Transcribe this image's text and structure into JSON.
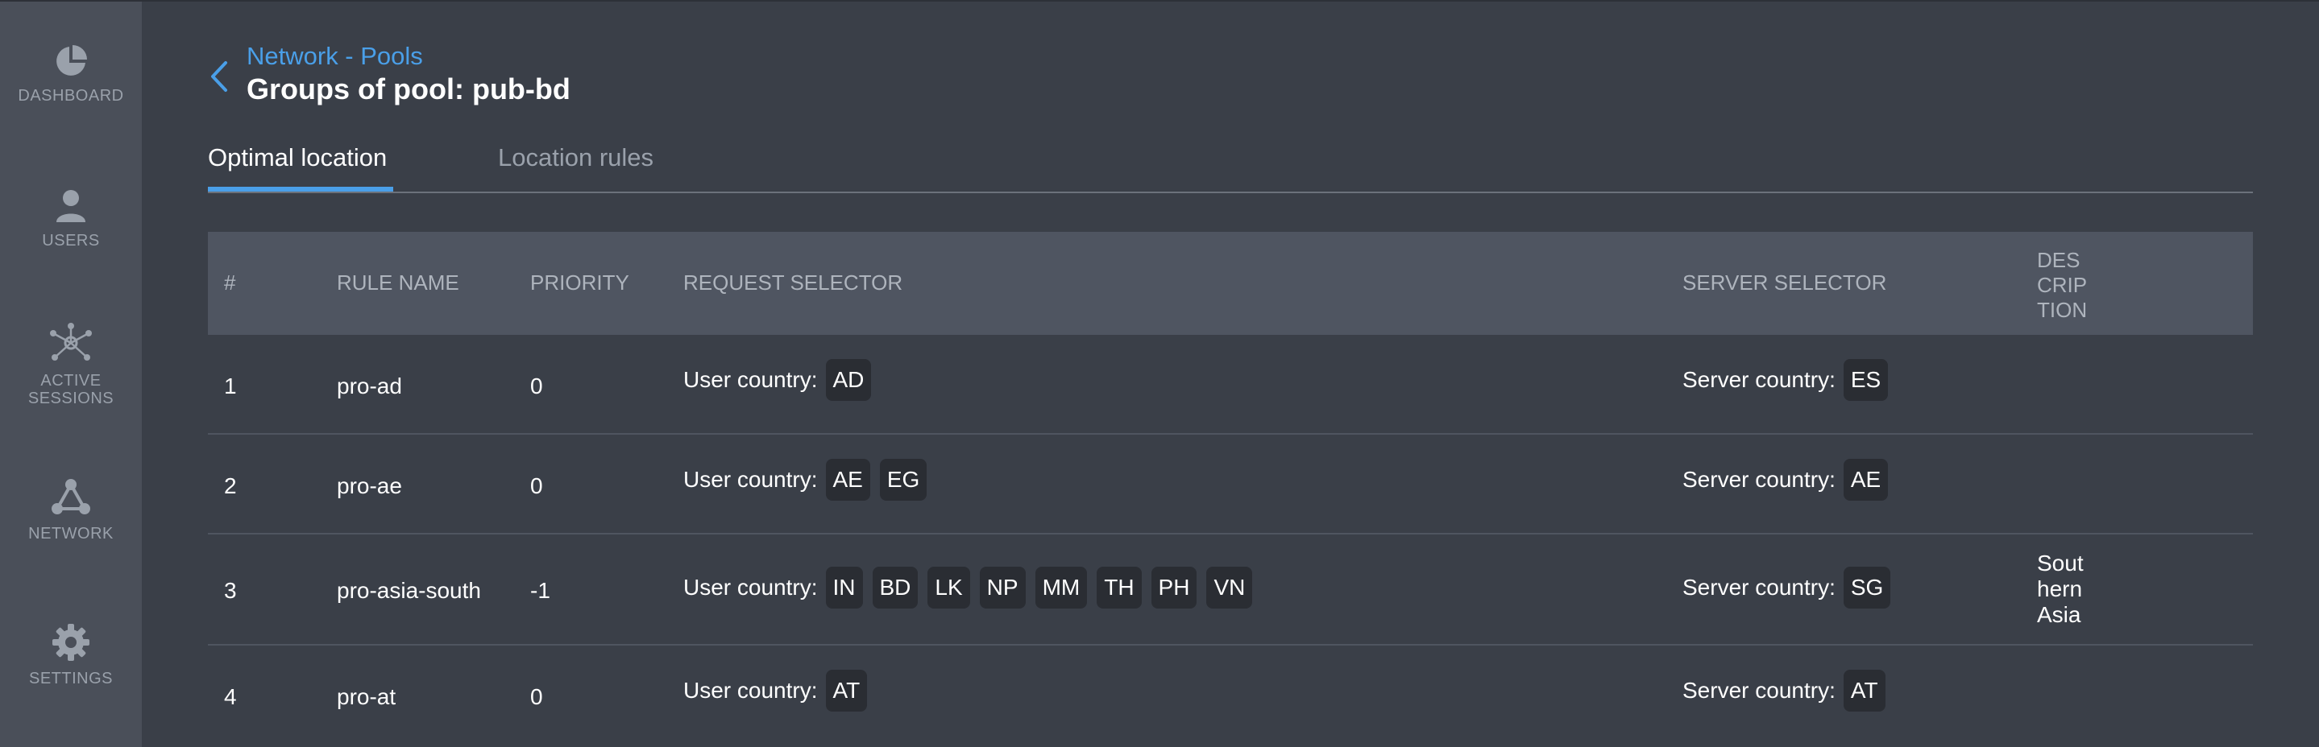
{
  "sidebar": {
    "items": [
      {
        "label": "DASHBOARD",
        "icon": "pie-chart-icon"
      },
      {
        "label": "USERS",
        "icon": "user-icon"
      },
      {
        "label": "ACTIVE SESSIONS",
        "icon": "sessions-icon"
      },
      {
        "label": "NETWORK",
        "icon": "network-icon"
      },
      {
        "label": "SETTINGS",
        "icon": "gear-icon"
      }
    ]
  },
  "header": {
    "breadcrumb": "Network - Pools",
    "title": "Groups of pool: pub-bd"
  },
  "tabs": [
    {
      "label": "Optimal location",
      "active": true
    },
    {
      "label": "Location rules",
      "active": false
    }
  ],
  "table": {
    "columns": {
      "num": "#",
      "rule_name": "RULE NAME",
      "priority": "PRIORITY",
      "request_selector": "REQUEST SELECTOR",
      "server_selector": "SERVER SELECTOR",
      "description": [
        "DES",
        "CRIP",
        "TION"
      ]
    },
    "user_country_label": "User country:",
    "server_country_label": "Server country:",
    "rows": [
      {
        "num": "1",
        "name": "pro-ad",
        "priority": "0",
        "user_countries": [
          "AD"
        ],
        "server_countries": [
          "ES"
        ],
        "description": []
      },
      {
        "num": "2",
        "name": "pro-ae",
        "priority": "0",
        "user_countries": [
          "AE",
          "EG"
        ],
        "server_countries": [
          "AE"
        ],
        "description": []
      },
      {
        "num": "3",
        "name": "pro-asia-south",
        "priority": "-1",
        "user_countries": [
          "IN",
          "BD",
          "LK",
          "NP",
          "MM",
          "TH",
          "PH",
          "VN"
        ],
        "server_countries": [
          "SG"
        ],
        "description": [
          "Sout",
          "hern",
          "Asia"
        ]
      },
      {
        "num": "4",
        "name": "pro-at",
        "priority": "0",
        "user_countries": [
          "AT"
        ],
        "server_countries": [
          "AT"
        ],
        "description": []
      }
    ]
  },
  "colors": {
    "accent": "#4a9fe8",
    "background": "#3a3f48",
    "sidebar": "#4a4f59",
    "chip": "#2a2d33"
  }
}
